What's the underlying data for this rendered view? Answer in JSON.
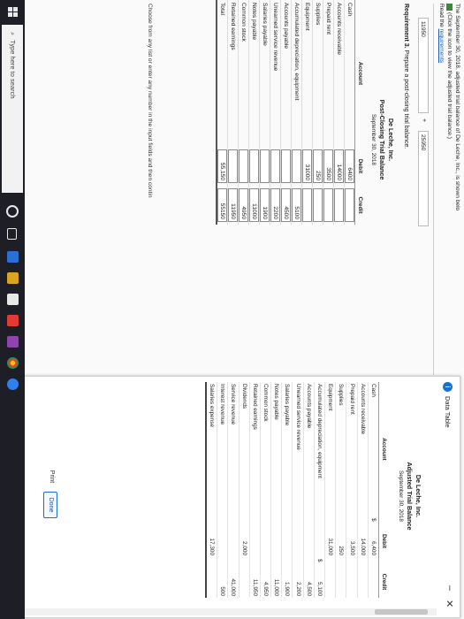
{
  "problem": {
    "line1": "The September 30, 2018, adjusted trial balance of De Leche, Inc., is shown belo",
    "line2": "(Click the icon to view the adjusted trial balance.)",
    "line3_prefix": "Read the ",
    "requirements_link": "requirements"
  },
  "prev_row": {
    "value1": "11950",
    "plus": "+",
    "value2": "25950"
  },
  "requirement": {
    "label": "Requirement 3.",
    "text": " Prepare a post-closing trial balance."
  },
  "post_closing": {
    "company": "De Leche, Inc.",
    "title": "Post-Closing Trial Balance",
    "date": "September 30, 2018",
    "col_account": "Account",
    "col_debit": "Debit",
    "col_credit": "Credit",
    "rows": [
      {
        "account": "Cash",
        "debit": "6400",
        "credit": ""
      },
      {
        "account": "Accounts receivable",
        "debit": "14000",
        "credit": ""
      },
      {
        "account": "Prepaid rent",
        "debit": "3500",
        "credit": ""
      },
      {
        "account": "Supplies",
        "debit": "250",
        "credit": ""
      },
      {
        "account": "Equipment",
        "debit": "31000",
        "credit": ""
      },
      {
        "account": "Accumulated depreciation, equipment",
        "debit": "",
        "credit": "5100"
      },
      {
        "account": "Accounts payable",
        "debit": "",
        "credit": "4500"
      },
      {
        "account": "Unearned service revenue",
        "debit": "",
        "credit": "2200"
      },
      {
        "account": "Salaries payable",
        "debit": "",
        "credit": "1900"
      },
      {
        "account": "Notes payable",
        "debit": "",
        "credit": "11000"
      },
      {
        "account": "Common stock",
        "debit": "",
        "credit": "4950"
      },
      {
        "account": "Retained earnings",
        "debit": "",
        "credit": "11950"
      }
    ],
    "total_label": "Total",
    "total_debit": "55,150",
    "total_credit": "55150"
  },
  "instruction": "Choose from any list or enter any number in the input fields and then contin",
  "taskbar": {
    "search_placeholder": "Type here to search"
  },
  "dialog": {
    "title": "Data Table",
    "minimize": "–",
    "close": "✕",
    "company": "De Leche, Inc.",
    "table_title": "Adjusted Trial Balance",
    "date": "September 30, 2018",
    "col_account": "Account",
    "col_debit": "Debit",
    "col_credit": "Credit",
    "rows": [
      {
        "account": "Cash",
        "dsign": "$",
        "debit": "6,400",
        "csign": "",
        "credit": ""
      },
      {
        "account": "Accounts receivable",
        "dsign": "",
        "debit": "14,000",
        "csign": "",
        "credit": ""
      },
      {
        "account": "Prepaid rent",
        "dsign": "",
        "debit": "3,500",
        "csign": "",
        "credit": ""
      },
      {
        "account": "Supplies",
        "dsign": "",
        "debit": "250",
        "csign": "",
        "credit": ""
      },
      {
        "account": "Equipment",
        "dsign": "",
        "debit": "31,000",
        "csign": "",
        "credit": ""
      },
      {
        "account": "Accumulated depreciation, equipment",
        "dsign": "",
        "debit": "",
        "csign": "$",
        "credit": "5,100"
      },
      {
        "account": "Accounts payable",
        "dsign": "",
        "debit": "",
        "csign": "",
        "credit": "4,500"
      },
      {
        "account": "Unearned service revenue",
        "dsign": "",
        "debit": "",
        "csign": "",
        "credit": "2,200"
      },
      {
        "account": "Salaries payable",
        "dsign": "",
        "debit": "",
        "csign": "",
        "credit": "1,900"
      },
      {
        "account": "Notes payable",
        "dsign": "",
        "debit": "",
        "csign": "",
        "credit": "11,000"
      },
      {
        "account": "Common stock",
        "dsign": "",
        "debit": "",
        "csign": "",
        "credit": "4,950"
      },
      {
        "account": "Retained earnings",
        "dsign": "",
        "debit": "",
        "csign": "",
        "credit": "11,950"
      },
      {
        "account": "Dividends",
        "dsign": "",
        "debit": "2,000",
        "csign": "",
        "credit": ""
      },
      {
        "account": "Service revenue",
        "dsign": "",
        "debit": "",
        "csign": "",
        "credit": "41,000"
      },
      {
        "account": "Interest revenue",
        "dsign": "",
        "debit": "",
        "csign": "",
        "credit": "500"
      },
      {
        "account": "Salaries expense",
        "dsign": "",
        "debit": "17,300",
        "csign": "",
        "credit": ""
      }
    ],
    "print_label": "Print",
    "done_label": "Done"
  }
}
